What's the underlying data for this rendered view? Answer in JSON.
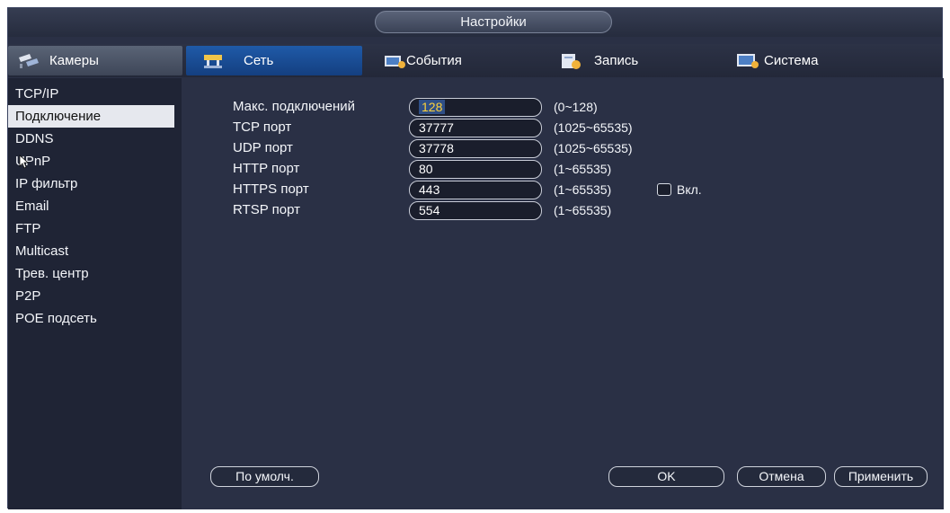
{
  "window": {
    "title": "Настройки"
  },
  "tabs": [
    {
      "label": "Камеры",
      "icon": "cameras-icon"
    },
    {
      "label": "Сеть",
      "icon": "network-icon",
      "active": true
    },
    {
      "label": "События",
      "icon": "events-icon"
    },
    {
      "label": "Запись",
      "icon": "record-icon"
    },
    {
      "label": "Система",
      "icon": "system-icon"
    }
  ],
  "sidebar": {
    "items": [
      {
        "label": "TCP/IP"
      },
      {
        "label": "Подключение",
        "active": true
      },
      {
        "label": "DDNS"
      },
      {
        "label": "UPnP"
      },
      {
        "label": "IP фильтр"
      },
      {
        "label": "Email"
      },
      {
        "label": "FTP"
      },
      {
        "label": "Multicast"
      },
      {
        "label": "Трев. центр"
      },
      {
        "label": "P2P"
      },
      {
        "label": "POE подсеть"
      }
    ]
  },
  "form": {
    "rows": [
      {
        "label": "Макс. подключений",
        "value": "128",
        "range": "(0~128)"
      },
      {
        "label": "TCP порт",
        "value": "37777",
        "range": "(1025~65535)"
      },
      {
        "label": "UDP порт",
        "value": "37778",
        "range": "(1025~65535)"
      },
      {
        "label": "HTTP порт",
        "value": "80",
        "range": "(1~65535)"
      },
      {
        "label": "HTTPS порт",
        "value": "443",
        "range": "(1~65535)"
      },
      {
        "label": "RTSP порт",
        "value": "554",
        "range": "(1~65535)"
      }
    ],
    "https_enable_label": "Вкл.",
    "https_enable_checked": false
  },
  "buttons": {
    "default": "По умолч.",
    "ok": "OK",
    "cancel": "Отмена",
    "apply": "Применить"
  },
  "colors": {
    "background": "#2a3045",
    "sidebar": "#1f2435",
    "active_tab": "#1f5aa8",
    "active_sidebar_item": "#e6e8ee",
    "selected_value": "#ffd23a"
  }
}
